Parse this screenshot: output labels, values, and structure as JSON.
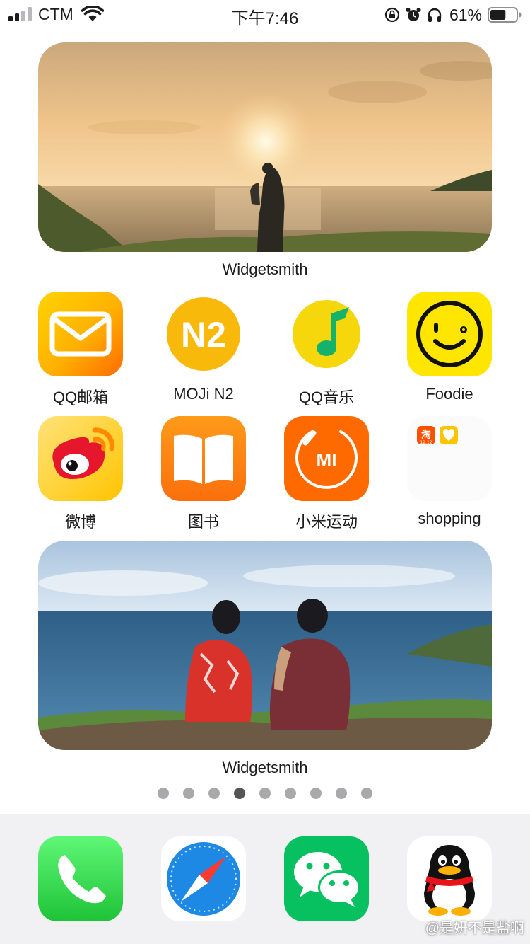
{
  "status_bar": {
    "carrier": "CTM",
    "time": "下午7:46",
    "battery_percent": "61%",
    "battery_level": 0.61,
    "signal_bars": 2
  },
  "widgets": [
    {
      "label": "Widgetsmith",
      "photo": "sunset-seaside-couple"
    },
    {
      "label": "Widgetsmith",
      "photo": "two-people-sitting-by-sea"
    }
  ],
  "apps": [
    {
      "label": "QQ邮箱",
      "icon": "mail-icon",
      "color": "#ff9a00"
    },
    {
      "label": "MOJi N2",
      "icon": "n2-icon",
      "icon_text": "N2",
      "color": "#f8b90b"
    },
    {
      "label": "QQ音乐",
      "icon": "music-note-icon",
      "color": "#f6d70b"
    },
    {
      "label": "Foodie",
      "icon": "smile-icon",
      "color": "#ffe600"
    },
    {
      "label": "微博",
      "icon": "weibo-icon",
      "color": "#ff9c00"
    },
    {
      "label": "图书",
      "icon": "book-icon",
      "color": "#ff8a10"
    },
    {
      "label": "小米运动",
      "icon": "mi-icon",
      "icon_text": "MI",
      "color": "#ff6a00"
    },
    {
      "label": "shopping",
      "icon": "folder-icon",
      "mini_taobao_text": "淘",
      "mini_taobao_caption": "12.12"
    }
  ],
  "page_indicator": {
    "count": 9,
    "active_index": 3
  },
  "dock": [
    {
      "name": "Phone",
      "icon": "phone-icon",
      "color": "#34c759"
    },
    {
      "name": "Safari",
      "icon": "compass-icon",
      "color": "#1e88e5"
    },
    {
      "name": "WeChat",
      "icon": "wechat-icon",
      "color": "#07c160"
    },
    {
      "name": "QQ",
      "icon": "penguin-icon",
      "color": "#000000"
    }
  ],
  "watermark": "@是妍不是盐啊"
}
